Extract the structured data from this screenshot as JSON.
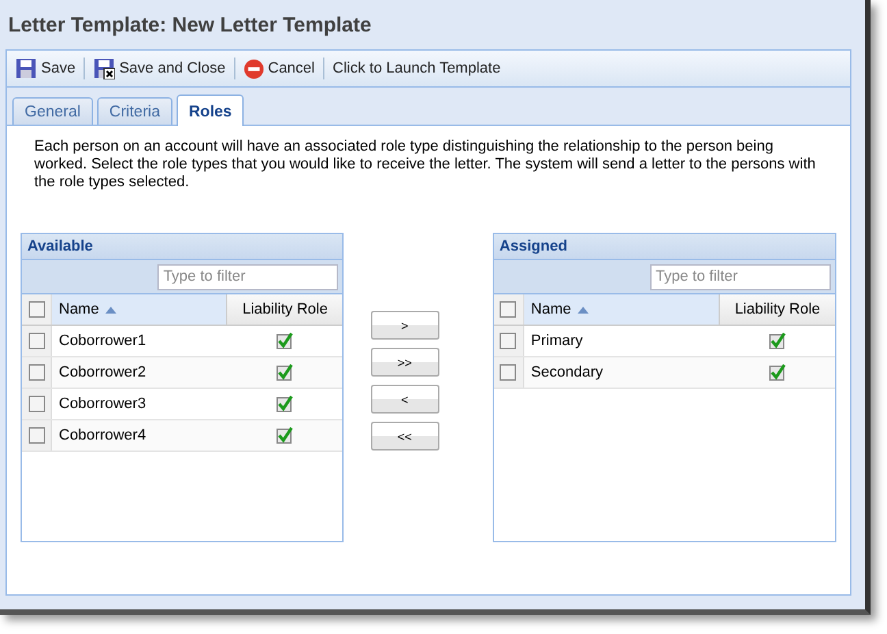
{
  "window": {
    "title": "Letter Template: New Letter Template"
  },
  "toolbar": [
    {
      "kind": "save",
      "label": "Save"
    },
    {
      "kind": "save-close",
      "label": "Save and Close"
    },
    {
      "kind": "cancel",
      "label": "Cancel"
    },
    {
      "kind": "plain",
      "label": "Click to Launch Template"
    }
  ],
  "tabs": [
    {
      "label": "General",
      "selected": false
    },
    {
      "label": "Criteria",
      "selected": false
    },
    {
      "label": "Roles",
      "selected": true
    }
  ],
  "description": "Each person on an account will have an associated role type distinguishing the relationship to the person being worked. Select the role types that you would like to receive the letter. The system will send a letter to the persons with the role types selected.",
  "available": {
    "title": "Available",
    "filter_placeholder": "Type to filter",
    "columns": [
      "Name",
      "Liability Role"
    ],
    "all_checked": false,
    "rows": [
      {
        "name": "Coborrower1",
        "checked": false,
        "liability_role": true
      },
      {
        "name": "Coborrower2",
        "checked": false,
        "liability_role": true
      },
      {
        "name": "Coborrower3",
        "checked": false,
        "liability_role": true
      },
      {
        "name": "Coborrower4",
        "checked": false,
        "liability_role": true
      }
    ]
  },
  "move_buttons": [
    ">",
    ">>",
    "<",
    "<<"
  ],
  "assigned": {
    "title": "Assigned",
    "filter_placeholder": "Type to filter",
    "columns": [
      "Name",
      "Liability Role"
    ],
    "all_checked": false,
    "rows": [
      {
        "name": "Primary",
        "checked": false,
        "liability_role": true
      },
      {
        "name": "Secondary",
        "checked": false,
        "liability_role": true
      }
    ]
  }
}
